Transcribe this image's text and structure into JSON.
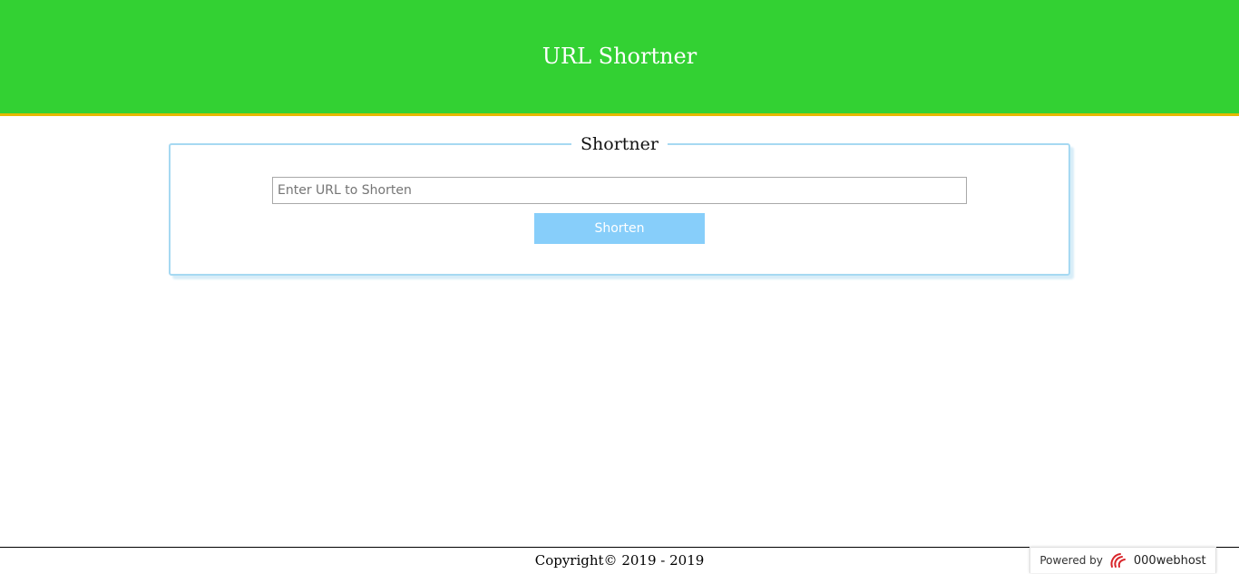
{
  "header": {
    "title": "URL Shortner",
    "background_color": "#33d133",
    "accent_border_color": "#e6b800"
  },
  "shortener": {
    "legend": "Shortner",
    "input_value": "",
    "input_placeholder": "Enter URL to Shorten",
    "button_label": "Shorten",
    "button_color": "#87cefa"
  },
  "footer": {
    "copyright": "Copyright© 2019 - 2019"
  },
  "badge": {
    "powered_label": "Powered by",
    "brand": "000webhost",
    "logo_icon": "000webhost-logo-icon"
  }
}
